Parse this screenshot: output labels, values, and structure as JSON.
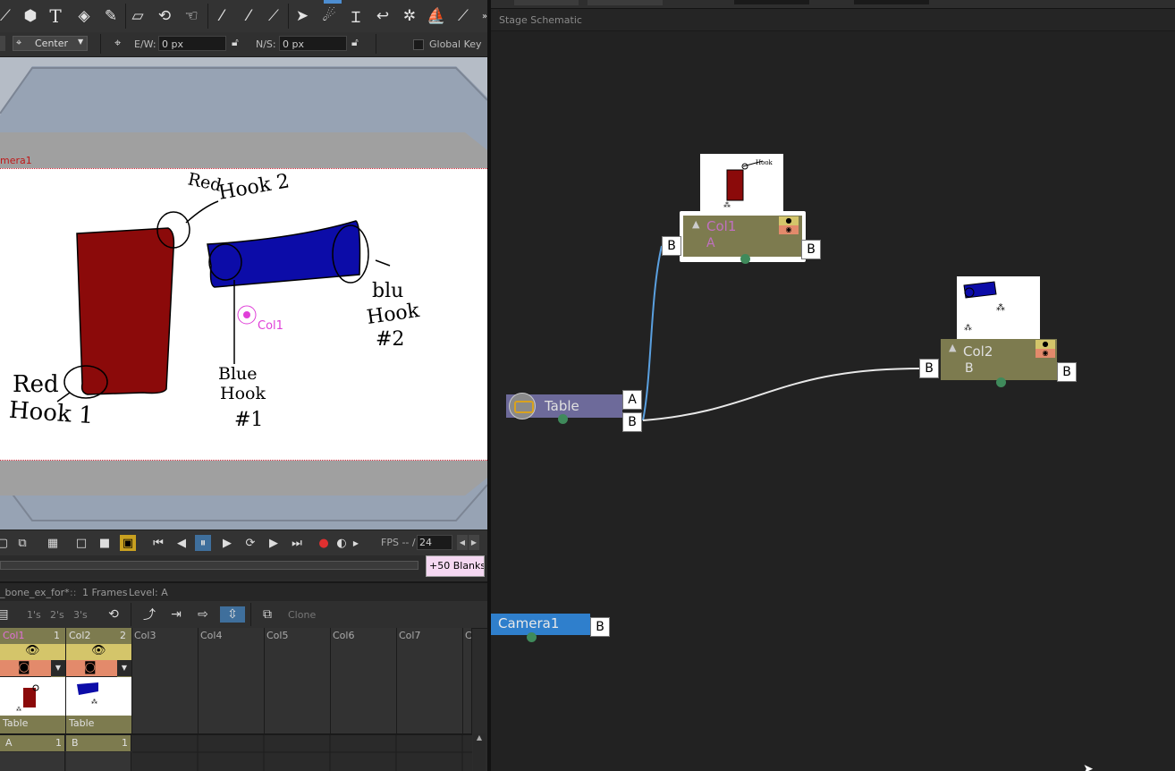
{
  "options": {
    "center_label": "Center",
    "ew_label": "E/W:",
    "ew_value": "0 px",
    "ns_label": "N/S:",
    "ns_value": "0 px",
    "global_key_label": "Global Key"
  },
  "viewer": {
    "camera_label": "mera1",
    "col_marker_label": "Col1",
    "drawing": {
      "red_hook2_line1": "Red",
      "red_hook2_line2": "Hook 2",
      "red_hook1_line1": "Red",
      "red_hook1_line2": "Hook 1",
      "blue_hook1_line1": "Blue",
      "blue_hook1_line2": "Hook",
      "blue_hook1_line3": "#1",
      "blue_hook2_line1": "blu",
      "blue_hook2_line2": "Hook",
      "blue_hook2_line3": "#2"
    }
  },
  "playback": {
    "fps_label": "FPS -- /",
    "fps_value": "24",
    "blanks_label": "+50 Blanks"
  },
  "xsheet": {
    "scene_name": "_bone_ex_for*",
    "separator": "::",
    "frames_info": "1 Frames",
    "level_info": "Level: A",
    "step_buttons": [
      "1's",
      "2's",
      "3's"
    ],
    "clone_label": "Clone",
    "columns": [
      {
        "name": "Col1",
        "number": "1",
        "parent": "Table",
        "cell": "A",
        "cell_num": "1"
      },
      {
        "name": "Col2",
        "number": "2",
        "parent": "Table",
        "cell": "B",
        "cell_num": "1"
      },
      {
        "name": "Col3"
      },
      {
        "name": "Col4"
      },
      {
        "name": "Col5"
      },
      {
        "name": "Col6"
      },
      {
        "name": "Col7"
      },
      {
        "name": "C"
      }
    ]
  },
  "schematic": {
    "title": "Stage Schematic",
    "nodes": {
      "col1": {
        "name": "Col1",
        "sub": "A",
        "port_left": "B",
        "port_right": "B"
      },
      "col2": {
        "name": "Col2",
        "sub": "B",
        "port_left": "B",
        "port_right": "B"
      },
      "table": {
        "name": "Table",
        "port_a": "A",
        "port_b": "B"
      },
      "camera": {
        "name": "Camera1",
        "port": "B"
      }
    }
  },
  "colors": {
    "node_olive": "#7d7b4f",
    "table_node": "#6d6a9a",
    "camera_node": "#2f7fcc",
    "red_fill": "#8b0a0a",
    "blue_fill": "#0c0ca8",
    "eye_yellow": "#d4c56a",
    "cam_orange": "#e38a6b"
  }
}
